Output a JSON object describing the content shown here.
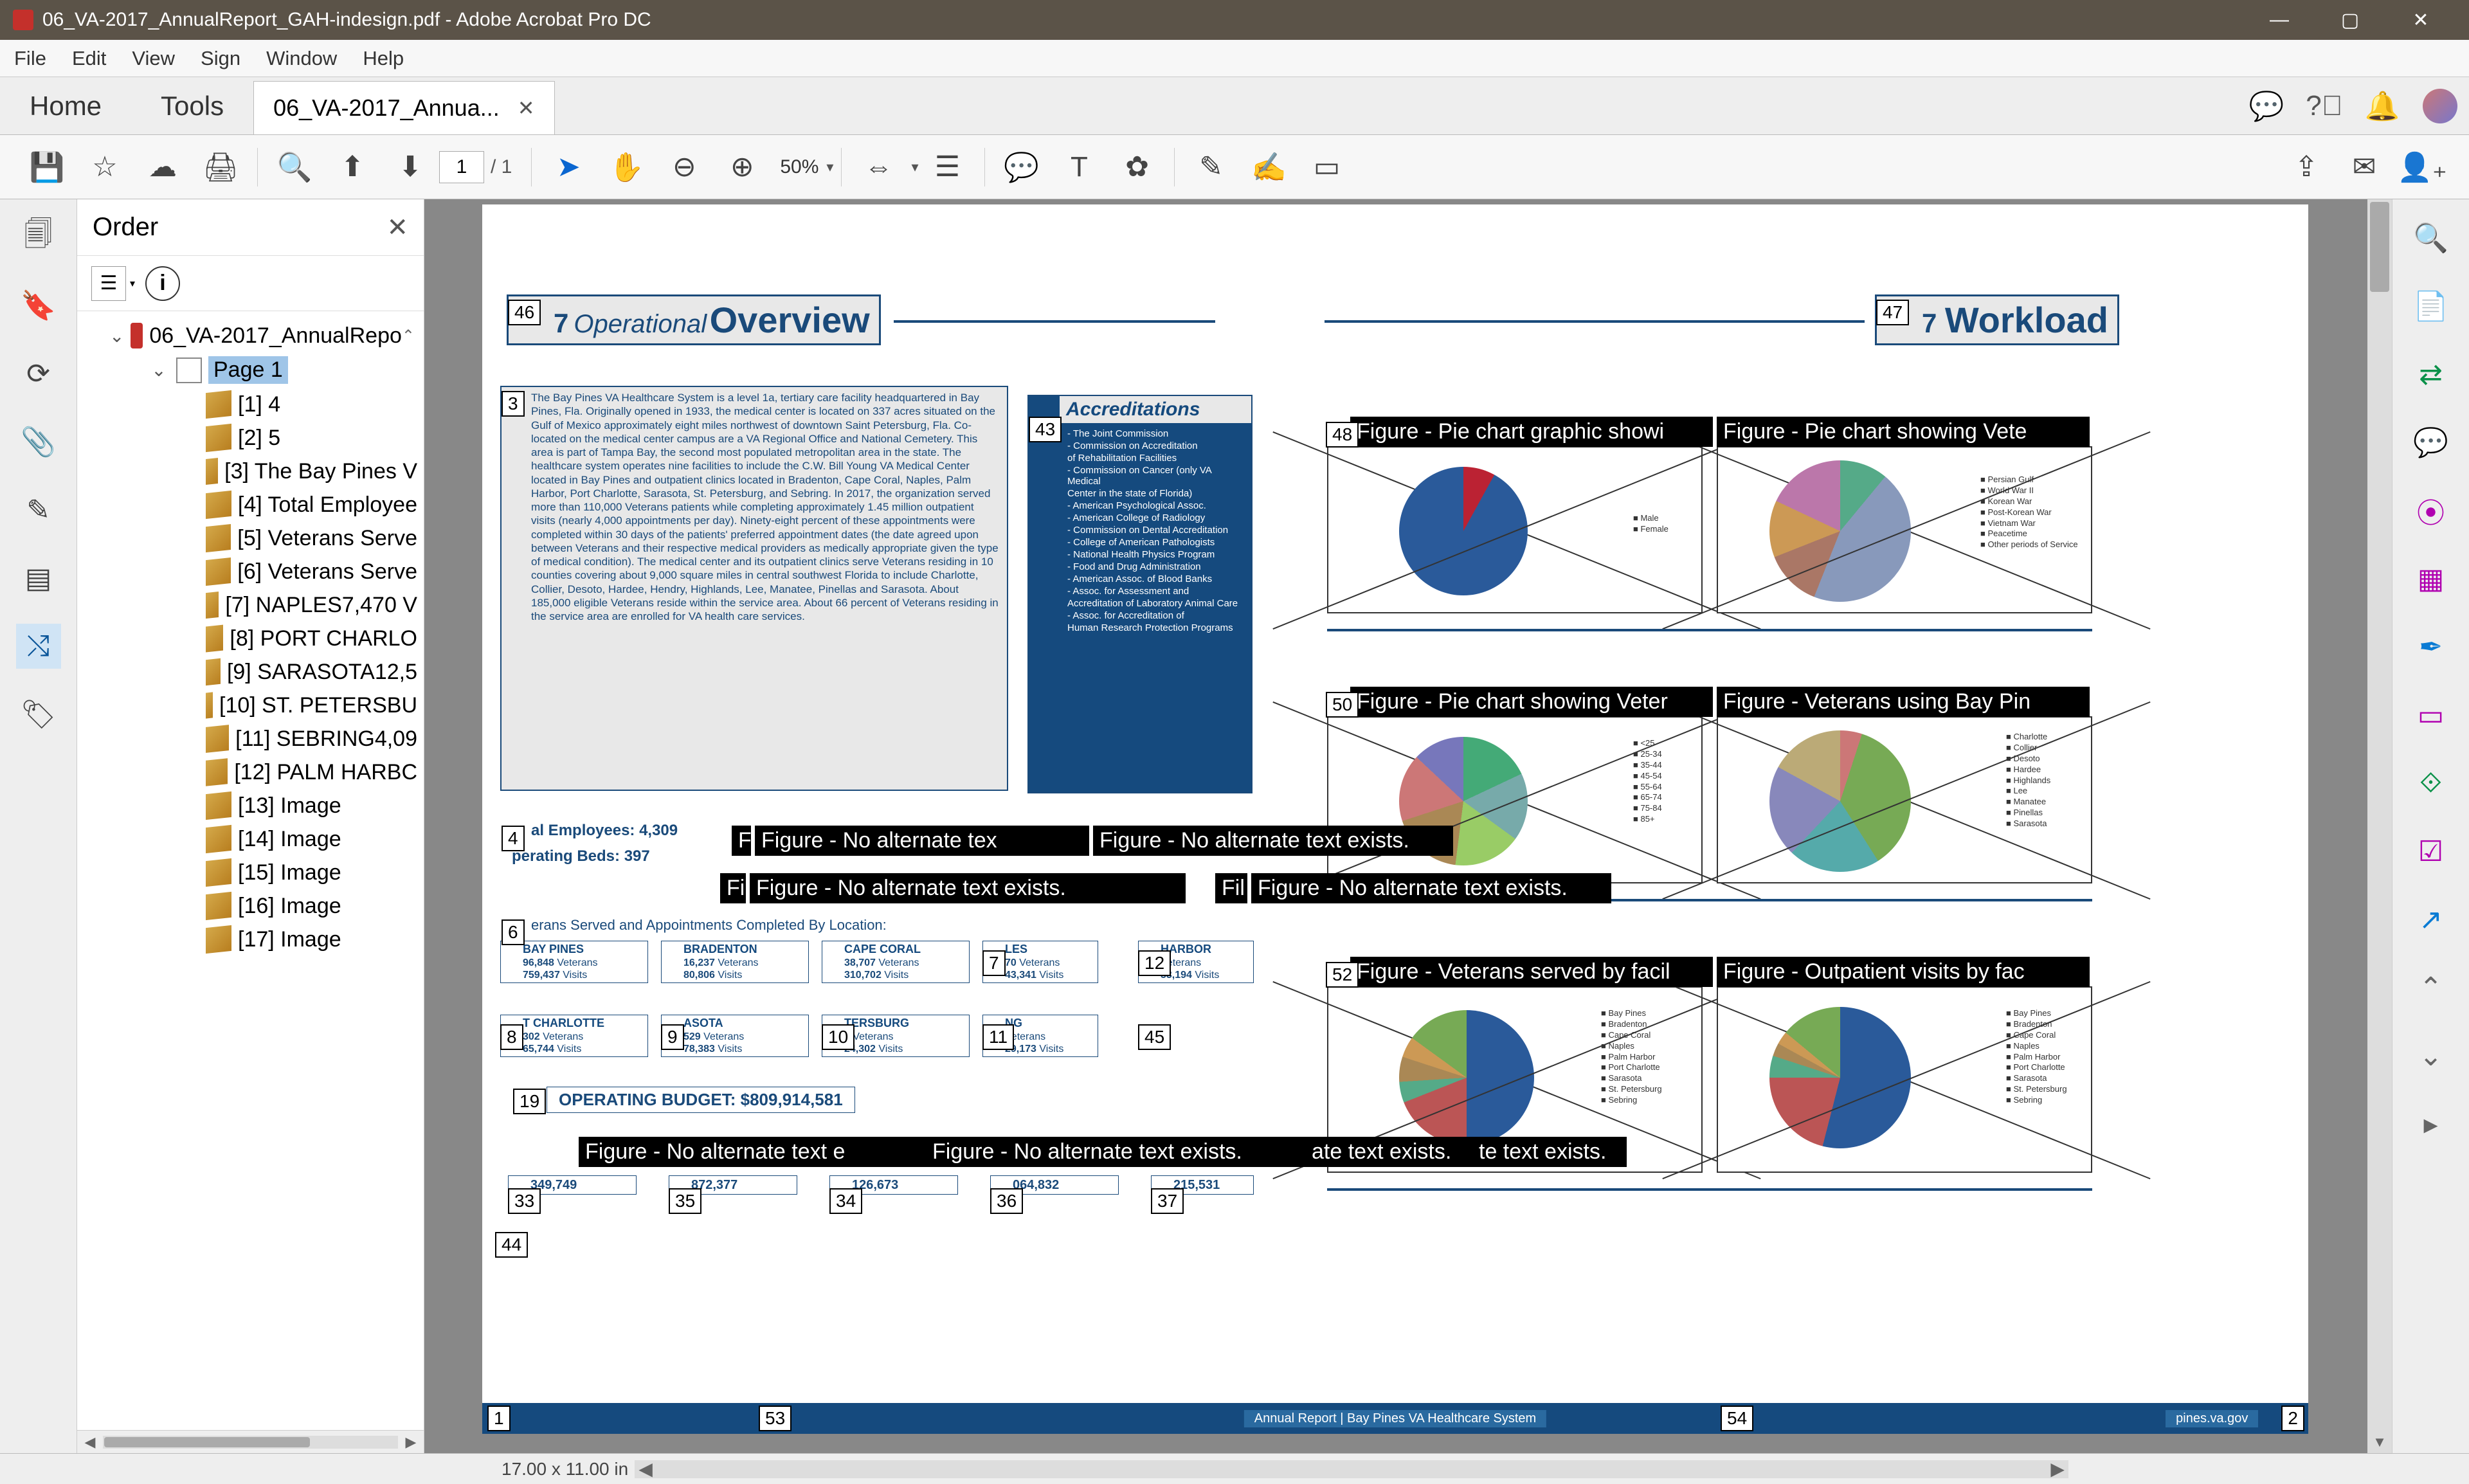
{
  "window": {
    "title": "06_VA-2017_AnnualReport_GAH-indesign.pdf - Adobe Acrobat Pro DC",
    "menu": [
      "File",
      "Edit",
      "View",
      "Sign",
      "Window",
      "Help"
    ],
    "win_min": "—",
    "win_max": "▢",
    "win_close": "✕"
  },
  "tabs": {
    "home": "Home",
    "tools": "Tools",
    "doc": "06_VA-2017_Annua...",
    "doc_close": "✕"
  },
  "toolbar": {
    "page_current": "1",
    "page_total": "/ 1",
    "zoom": "50%"
  },
  "panel": {
    "title": "Order",
    "root": "06_VA-2017_AnnualRepo",
    "page": "Page 1",
    "items": [
      "[1] 4",
      "[2] 5",
      "[3] The Bay Pines V",
      "[4] Total Employee",
      "[5] Veterans Serve",
      "[6] Veterans Serve",
      "[7] NAPLES7,470 V",
      "[8] PORT CHARLO",
      "[9] SARASOTA12,5",
      "[10] ST. PETERSBU",
      "[11] SEBRING4,09",
      "[12] PALM HARBC",
      "[13] Image",
      "[14] Image",
      "[15] Image",
      "[16] Image",
      "[17] Image"
    ]
  },
  "doc": {
    "head_l_num": "7",
    "head_l_ital": "Operational",
    "head_l_big": "Overview",
    "head_r_num": "7",
    "head_r_big": "Workload",
    "tags": {
      "t46": "46",
      "t47": "47",
      "t3": "3",
      "t43": "43",
      "t48": "48",
      "t50": "50",
      "t52": "52",
      "t4": "4",
      "t6": "6",
      "t7": "7",
      "t8": "8",
      "t9": "9",
      "t10": "10",
      "t11": "11",
      "t12": "12",
      "t19": "19",
      "t45": "45",
      "t33": "33",
      "t35": "35",
      "t34": "34",
      "t36": "36",
      "t37": "37",
      "t44": "44",
      "t1": "1",
      "t2": "2",
      "t53": "53",
      "t54": "54"
    },
    "body": "The Bay Pines VA Healthcare System is a level 1a, tertiary care facility headquartered in Bay Pines, Fla. Originally opened in 1933, the medical center is located on 337 acres situated on the Gulf of Mexico approximately eight miles northwest of downtown Saint Petersburg, Fla. Co-located on the medical center campus are a VA Regional Office and National Cemetery. This area is part of Tampa Bay, the second most populated metropolitan area in the state. The healthcare system operates nine facilities to include the C.W. Bill Young VA Medical Center located in Bay Pines and outpatient clinics located in Bradenton, Cape Coral, Naples, Palm Harbor, Port Charlotte, Sarasota, St. Petersburg, and Sebring. In 2017, the organization served more than 110,000 Veterans patients while completing approximately 1.45 million outpatient visits (nearly 4,000 appointments per day). Ninety-eight percent of these appointments were completed within 30 days of the patients' preferred appointment dates (the date agreed upon between Veterans and their respective medical providers as medically appropriate given the type of medical condition). The medical center and its outpatient clinics serve Veterans residing in 10 counties covering about 9,000 square miles in central southwest Florida to include Charlotte, Collier, Desoto, Hardee, Hendry, Highlands, Lee, Manatee, Pinellas and Sarasota. About 185,000 eligible Veterans reside within the service area. About 66 percent of Veterans residing in the service area are enrolled for VA health care services.",
    "acc_title": "Accreditations",
    "acc_items": [
      "- The Joint Commission",
      "- Commission on Accreditation",
      "  of Rehabilitation Facilities",
      "- Commission on Cancer (only VA Medical",
      "  Center in the state of Florida)",
      "- American Psychological Assoc.",
      "- American College of Radiology",
      "- Commission on Dental Accreditation",
      "- College of American Pathologists",
      "- National Health Physics Program",
      "- Food and Drug Administration",
      "- American Assoc. of Blood Banks",
      "- Assoc. for Assessment and",
      "Accreditation of Laboratory Animal Care",
      "- Assoc. for Accreditation of",
      "Human Research Protection Programs"
    ],
    "stats": {
      "emp": "al Employees:  4,309",
      "beds": "perating Beds:  397",
      "served": "erans Served and Appointments Completed By Location:"
    },
    "locations": [
      {
        "n": "BAY PINES",
        "v": "96,848",
        "a": "759,437"
      },
      {
        "n": "BRADENTON",
        "v": "16,237",
        "a": "80,806"
      },
      {
        "n": "CAPE CORAL",
        "v": "38,707",
        "a": "310,702"
      },
      {
        "n": "LES",
        "v": "70",
        "a": "43,341"
      },
      {
        "n": "HARBOR",
        "v": "",
        "a": "53,194"
      },
      {
        "n": "T CHARLOTTE",
        "v": "302",
        "a": "65,744"
      },
      {
        "n": "ASOTA",
        "v": "529",
        "a": "78,383"
      },
      {
        "n": "TERSBURG",
        "v": "2",
        "a": "24,302"
      },
      {
        "n": "NG",
        "v": "",
        "a": "29,173"
      }
    ],
    "budget": "OPERATING BUDGET:  $809,914,581",
    "bottom_vals": [
      "349,749",
      "872,377",
      "126,673",
      "064,832",
      "215,531"
    ],
    "overlays": {
      "o48": "Figure - Pie chart graphic showi",
      "o48b": "Figure - Pie chart showing Vete",
      "o50": "Figure - Pie chart showing Veter",
      "o50b": "Figure - Veterans using Bay Pin",
      "o52": "Figure - Veterans served by facil",
      "o52b": "Figure - Outpatient visits by fac",
      "oa": "Figure - No alternate tex",
      "ob": "Figure - No alternate text exists.",
      "oc": "Figure - No alternate text exists.",
      "od": "Figure - No alternate text exists.",
      "oe": "Figure - No alternate text e",
      "of": "Figure - No alternate text exists.",
      "og": "ate text exists.",
      "oh": "te text exists.",
      "fi": "Fi",
      "fil": "Fil",
      "f": "F"
    },
    "legends": {
      "r1": [
        "■ Male",
        "■ Female"
      ],
      "r1b": [
        "■ Persian Gulf",
        "■ World War II",
        "■ Korean War",
        "■ Post-Korean War",
        "■ Vietnam War",
        "■ Peacetime",
        "■ Other periods of Service"
      ],
      "r2": [
        "■ <25",
        "■ 25-34",
        "■ 35-44",
        "■ 45-54",
        "■ 55-64",
        "■ 65-74",
        "■ 75-84",
        "■ 85+"
      ],
      "r2b": [
        "■ Charlotte",
        "■ Collier",
        "■ Desoto",
        "■ Hardee",
        "■ Highlands",
        "■ Lee",
        "■ Manatee",
        "■ Pinellas",
        "■ Sarasota"
      ],
      "r3": [
        "■ Bay Pines",
        "■ Bradenton",
        "■ Cape Coral",
        "■ Naples",
        "■ Palm Harbor",
        "■ Port Charlotte",
        "■ Sarasota",
        "■ St. Petersburg",
        "■ Sebring"
      ],
      "r3b": [
        "■ Bay Pines",
        "■ Bradenton",
        "■ Cape Coral",
        "■ Naples",
        "■ Palm Harbor",
        "■ Port Charlotte",
        "■ Sarasota",
        "■ St. Petersburg",
        "■ Sebring"
      ]
    },
    "pievals": {
      "p1": [
        "8%",
        "92%"
      ],
      "p1b": [
        "11%",
        "45%",
        "13%"
      ],
      "p2": [
        "18%",
        "17%",
        "7%"
      ],
      "p2b": [
        "5%",
        "36%",
        "21%",
        "1%",
        "4%"
      ],
      "p3": [
        "1% 2%",
        "4%",
        "19%",
        "5%",
        "50%",
        "5%",
        "6%"
      ],
      "p3b": [
        "2% 2%",
        "3%",
        "21%",
        "5%",
        "54%"
      ]
    },
    "footer_mid": "Annual Report | Bay Pines VA Healthcare System",
    "footer_rt": "pines.va.gov"
  },
  "statusbar": {
    "dim": "17.00 x 11.00 in"
  }
}
